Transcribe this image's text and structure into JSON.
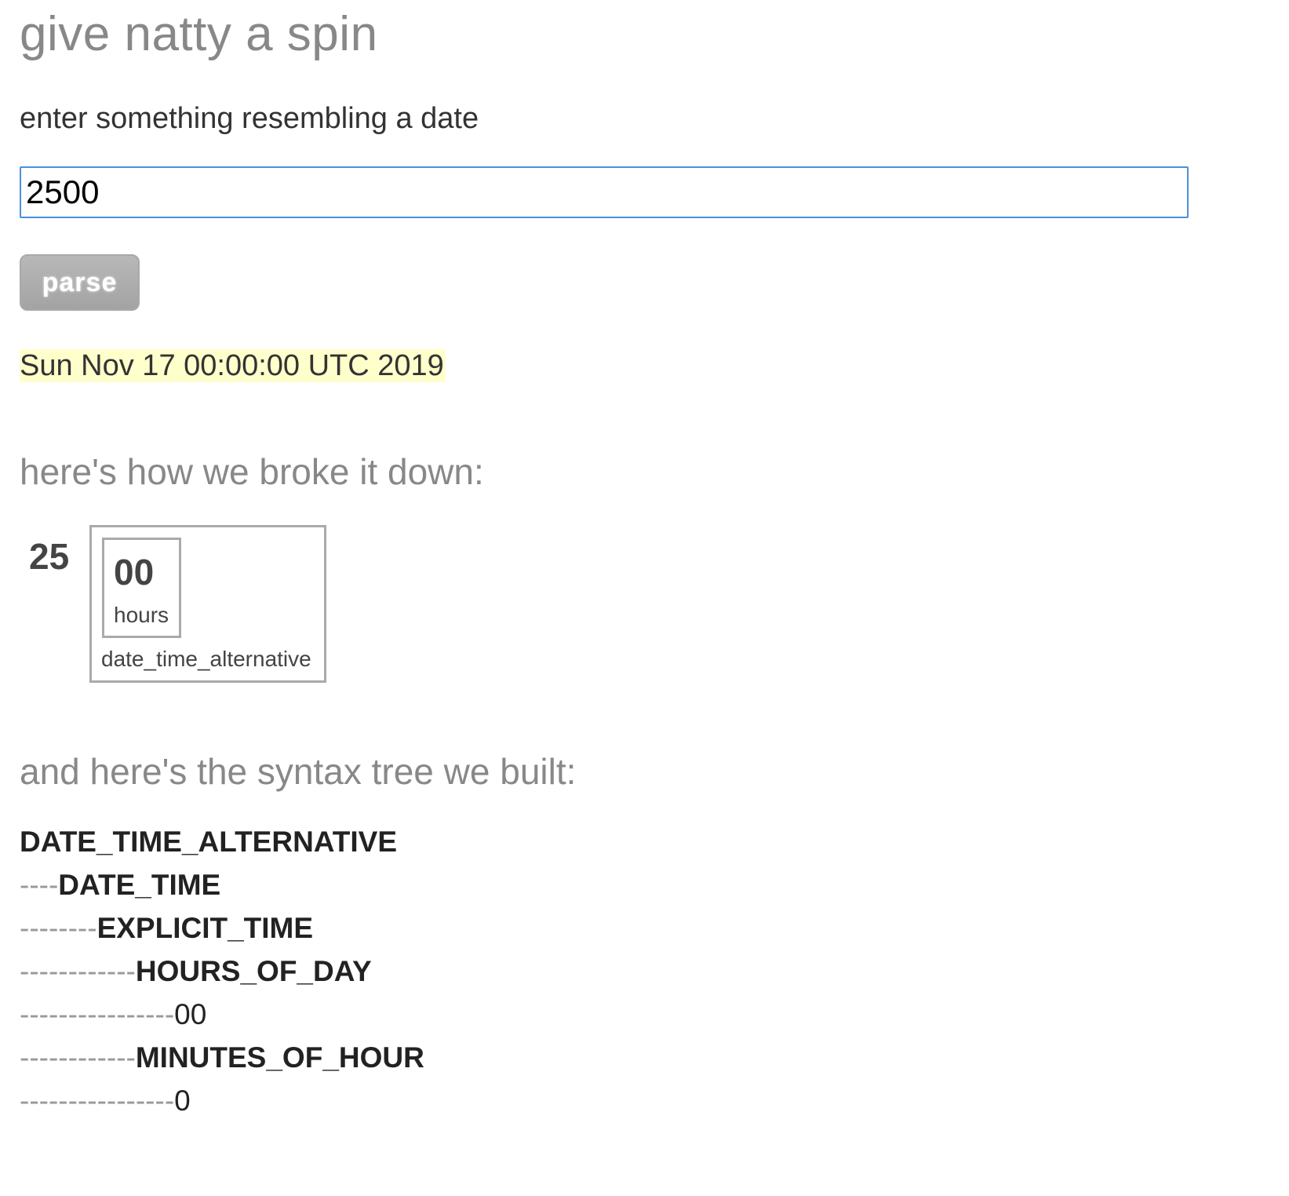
{
  "page": {
    "title": "give natty a spin",
    "prompt": "enter something resembling a date"
  },
  "form": {
    "input_value": "2500",
    "parse_label": "parse"
  },
  "result": {
    "parsed_date": "Sun Nov 17 00:00:00 UTC 2019"
  },
  "breakdown": {
    "heading": "here's how we broke it down:",
    "plain_token": "25",
    "group_label": "date_time_alternative",
    "token_value": "00",
    "token_label": "hours"
  },
  "tree": {
    "heading": "and here's the syntax tree we built:",
    "nodes": [
      {
        "dashes": "",
        "label": "DATE_TIME_ALTERNATIVE",
        "kind": "rule"
      },
      {
        "dashes": "----",
        "label": "DATE_TIME",
        "kind": "rule"
      },
      {
        "dashes": "--------",
        "label": "EXPLICIT_TIME",
        "kind": "rule"
      },
      {
        "dashes": "------------",
        "label": "HOURS_OF_DAY",
        "kind": "rule"
      },
      {
        "dashes": "----------------",
        "label": "00",
        "kind": "leaf"
      },
      {
        "dashes": "------------",
        "label": "MINUTES_OF_HOUR",
        "kind": "rule"
      },
      {
        "dashes": "----------------",
        "label": "0",
        "kind": "leaf"
      }
    ]
  }
}
